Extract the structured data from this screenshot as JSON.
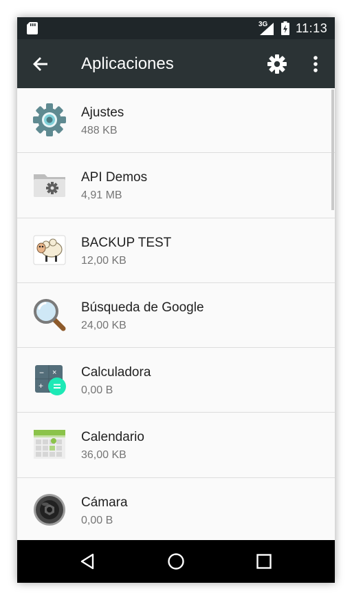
{
  "status_bar": {
    "time": "11:13",
    "network": "3G",
    "icons": [
      "sd-card-icon",
      "signal-icon",
      "battery-charging-icon"
    ]
  },
  "app_bar": {
    "title": "Aplicaciones",
    "back_icon": "arrow-back-icon",
    "settings_icon": "gear-icon",
    "overflow_icon": "more-vert-icon"
  },
  "apps": [
    {
      "name": "Ajustes",
      "size": "488 KB",
      "icon": "settings-gear-icon"
    },
    {
      "name": "API Demos",
      "size": "4,91 MB",
      "icon": "folder-gear-icon"
    },
    {
      "name": "BACKUP TEST",
      "size": "12,00 KB",
      "icon": "sheep-icon"
    },
    {
      "name": "Búsqueda de Google",
      "size": "24,00 KB",
      "icon": "magnifier-icon"
    },
    {
      "name": "Calculadora",
      "size": "0,00 B",
      "icon": "calculator-icon"
    },
    {
      "name": "Calendario",
      "size": "36,00 KB",
      "icon": "calendar-icon"
    },
    {
      "name": "Cámara",
      "size": "0,00 B",
      "icon": "camera-icon"
    }
  ],
  "nav_bar": {
    "back_icon": "nav-back-icon",
    "home_icon": "nav-home-icon",
    "recents_icon": "nav-recents-icon"
  },
  "colors": {
    "status_bar": "#1f2629",
    "app_bar": "#2b3335",
    "list_background": "#fafafa",
    "divider": "#dcdcdc",
    "primary_text": "#212121",
    "secondary_text": "#757575",
    "nav_bar": "#000000"
  }
}
